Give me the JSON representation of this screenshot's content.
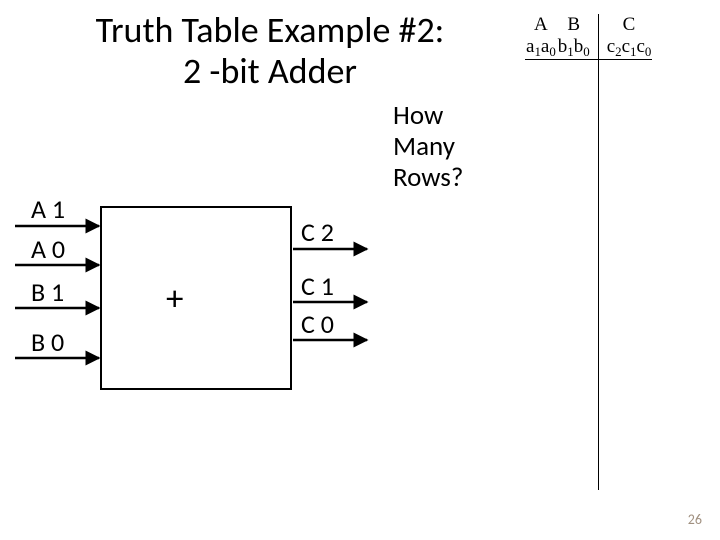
{
  "title_line1": "Truth Table Example #2:",
  "title_line2": "2 -bit Adder",
  "question_l1": "How",
  "question_l2": "Many",
  "question_l3": "Rows?",
  "inputs": {
    "a1": "A 1",
    "a0": "A 0",
    "b1": "B 1",
    "b0": "B 0"
  },
  "outputs": {
    "c2": "C 2",
    "c1": "C 1",
    "c0": "C 0"
  },
  "op": "+",
  "table": {
    "headA": "A",
    "headB": "B",
    "headC": "C",
    "subA": "a₁a₀",
    "subB": "b₁b₀",
    "subC": "c₂c₁c₀"
  },
  "pagenum": "26"
}
